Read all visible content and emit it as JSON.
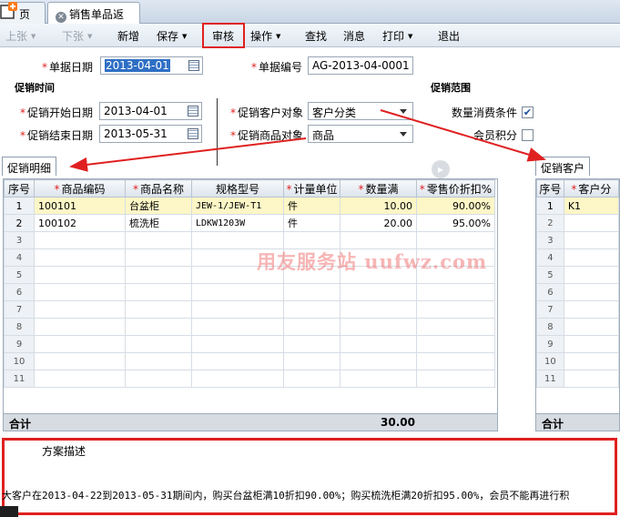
{
  "tabs": {
    "home": "页",
    "active": "销售单品返现"
  },
  "toolbar": {
    "prev": "上张",
    "next": "下张",
    "add": "新增",
    "save": "保存",
    "audit": "审核",
    "operate": "操作",
    "query": "查找",
    "message": "消息",
    "print": "打印",
    "exit": "退出"
  },
  "form": {
    "bill_date_label": "单据日期",
    "bill_date": "2013-04-01",
    "bill_no_label": "单据编号",
    "bill_no": "AG-2013-04-0001",
    "promo_time_title": "促销时间",
    "promo_range_title": "促销范围",
    "start_label": "促销开始日期",
    "start_date": "2013-04-01",
    "end_label": "促销结束日期",
    "end_date": "2013-05-31",
    "customer_target_label": "促销客户对象",
    "customer_target": "客户分类",
    "product_target_label": "促销商品对象",
    "product_target": "商品",
    "qty_condition_label": "数量消费条件",
    "qty_condition_checked": true,
    "member_points_label": "会员积分",
    "member_points_checked": false
  },
  "detail": {
    "tab_label": "促销明细",
    "columns": [
      "序号",
      "商品编码",
      "商品名称",
      "规格型号",
      "计量单位",
      "数量满",
      "零售价折扣%"
    ],
    "required": [
      false,
      true,
      true,
      false,
      true,
      true,
      true
    ],
    "rows": [
      {
        "no": "1",
        "code": "100101",
        "name": "台盆柜",
        "spec": "JEW-1/JEW-T1",
        "unit": "件",
        "qty": "10.00",
        "discount": "90.00%"
      },
      {
        "no": "2",
        "code": "100102",
        "name": "梳洗柜",
        "spec": "LDKW1203W",
        "unit": "件",
        "qty": "20.00",
        "discount": "95.00%"
      }
    ],
    "empty_rows": [
      "3",
      "4",
      "5",
      "6",
      "7",
      "8",
      "9",
      "10",
      "11"
    ],
    "total_label": "合计",
    "total_qty": "30.00"
  },
  "customers": {
    "tab_label": "促销客户",
    "columns": [
      "序号",
      "客户分"
    ],
    "rows": [
      {
        "no": "1",
        "code": "K1"
      }
    ],
    "empty_rows": [
      "2",
      "3",
      "4",
      "5",
      "6",
      "7",
      "8",
      "9",
      "10",
      "11"
    ],
    "total_label": "合计"
  },
  "watermark": "用友服务站 uufwz.com",
  "description": {
    "label": "方案描述",
    "text": "大客户在2013-04-22到2013-05-31期间内，购买台盆柜满10折扣90.00%；购买梳洗柜满20折扣95.00%，会员不能再进行积"
  },
  "colors": {
    "annotation_red": "#e02020",
    "row_highlight": "#fdf6c6",
    "selection_blue": "#2f6fc4"
  }
}
